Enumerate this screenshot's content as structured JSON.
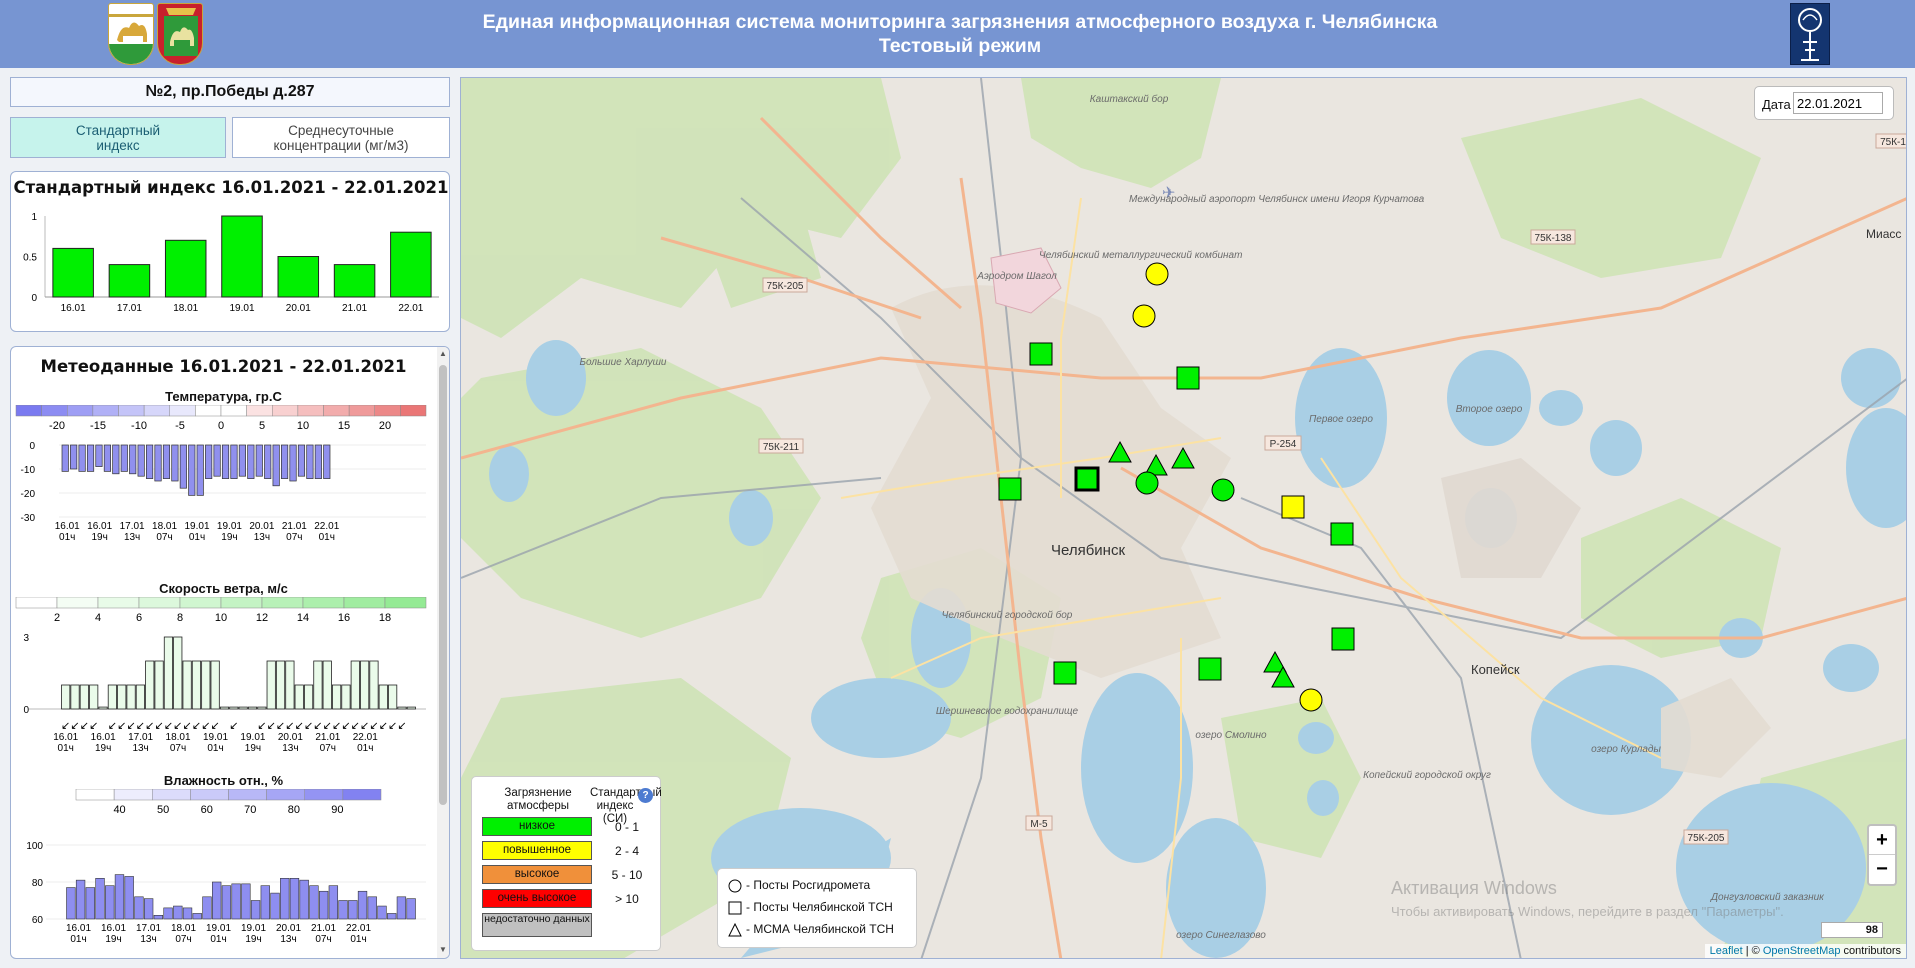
{
  "header": {
    "title": "Единая информационная система мониторинга загрязнения атмосферного воздуха г. Челябинска",
    "subtitle": "Тестовый режим",
    "colors": {
      "bg": "#7795d2"
    }
  },
  "station": {
    "label": "№2, пр.Победы д.287"
  },
  "tabs": [
    {
      "label_line1": "Стандартный",
      "label_line2": "индекс"
    },
    {
      "label_line1": "Среднесуточные",
      "label_line2": "концентрации (мг/м3)"
    }
  ],
  "chart_data": [
    {
      "type": "bar",
      "title": "Стандартный индекс 16.01.2021 - 22.01.2021",
      "categories": [
        "16.01",
        "17.01",
        "18.01",
        "19.01",
        "20.01",
        "21.01",
        "22.01"
      ],
      "values": [
        0.6,
        0.4,
        0.7,
        1.0,
        0.5,
        0.4,
        0.8
      ],
      "ylim": [
        0,
        1
      ],
      "yticks": [
        "0",
        "0.5",
        "1"
      ],
      "bar_color": "#00f000"
    },
    {
      "type": "bar",
      "title": "Температура, гр.С",
      "ylim": [
        -30,
        0
      ],
      "yticks": [
        "0",
        "-10",
        "-20",
        "-30"
      ],
      "values": [
        -11,
        -10,
        -11,
        -11,
        -9,
        -11,
        -12,
        -11,
        -12,
        -13,
        -14,
        -15,
        -14,
        -15,
        -18,
        -21,
        -21,
        -14,
        -13,
        -14,
        -14,
        -13,
        -14,
        -13,
        -14,
        -17,
        -14,
        -15,
        -13,
        -14,
        -14,
        -14
      ],
      "x_labels": [
        [
          "16.01",
          "01ч"
        ],
        [
          "16.01",
          "19ч"
        ],
        [
          "17.01",
          "13ч"
        ],
        [
          "18.01",
          "07ч"
        ],
        [
          "19.01",
          "01ч"
        ],
        [
          "19.01",
          "19ч"
        ],
        [
          "20.01",
          "13ч"
        ],
        [
          "21.01",
          "07ч"
        ],
        [
          "22.01",
          "01ч"
        ]
      ],
      "scale": [
        "-20",
        "-15",
        "-10",
        "-5",
        "0",
        "5",
        "10",
        "15",
        "20"
      ],
      "bar_color": "#9090ee"
    },
    {
      "type": "bar",
      "title": "Скорость ветра, м/с",
      "ylim": [
        0,
        3
      ],
      "yticks": [
        "3",
        "0"
      ],
      "values": [
        1,
        1,
        1,
        1,
        0,
        1,
        1,
        1,
        1,
        2,
        2,
        3,
        3,
        2,
        2,
        2,
        2,
        0,
        0,
        0,
        0,
        0,
        2,
        2,
        2,
        1,
        1,
        2,
        2,
        1,
        1,
        2,
        2,
        2,
        1,
        1,
        0,
        0
      ],
      "x_labels": [
        [
          "16.01",
          "01ч"
        ],
        [
          "16.01",
          "19ч"
        ],
        [
          "17.01",
          "13ч"
        ],
        [
          "18.01",
          "07ч"
        ],
        [
          "19.01",
          "01ч"
        ],
        [
          "19.01",
          "19ч"
        ],
        [
          "20.01",
          "13ч"
        ],
        [
          "21.01",
          "07ч"
        ],
        [
          "22.01",
          "01ч"
        ]
      ],
      "scale": [
        "2",
        "4",
        "6",
        "8",
        "10",
        "12",
        "14",
        "16",
        "18"
      ],
      "bar_color": "#eafbea"
    },
    {
      "type": "bar",
      "title": "Влажность отн., %",
      "ylim": [
        60,
        100
      ],
      "yticks": [
        "100",
        "80",
        "60"
      ],
      "values": [
        77,
        81,
        77,
        82,
        78,
        84,
        83,
        72,
        71,
        62,
        66,
        67,
        66,
        63,
        72,
        80,
        78,
        79,
        79,
        70,
        78,
        74,
        82,
        82,
        81,
        78,
        75,
        78,
        70,
        70,
        75,
        72,
        67,
        63,
        72,
        71
      ],
      "x_labels": [
        [
          "16.01",
          "01ч"
        ],
        [
          "16.01",
          "19ч"
        ],
        [
          "17.01",
          "13ч"
        ],
        [
          "18.01",
          "07ч"
        ],
        [
          "19.01",
          "01ч"
        ],
        [
          "19.01",
          "19ч"
        ],
        [
          "20.01",
          "13ч"
        ],
        [
          "21.01",
          "07ч"
        ],
        [
          "22.01",
          "01ч"
        ]
      ],
      "scale": [
        "40",
        "50",
        "60",
        "70",
        "80",
        "90"
      ],
      "bar_color": "#8e8ef0"
    }
  ],
  "meteo": {
    "title": "Метеоданные 16.01.2021 - 22.01.2021"
  },
  "map": {
    "date_label": "Дата",
    "date_value": "22.01.2021",
    "places": {
      "chelyabinsk": "Челябинск",
      "kopeysk": "Копейск",
      "kashtak": "Каштакский бор",
      "airport": "Международный аэропорт Челябинск имени Игоря Курчатова",
      "chmk": "Челябинский металлургический комбинат",
      "shagol": "Аэродром Шагол",
      "b_harlushi": "Большие Харлуши",
      "pervoe": "Первое озеро",
      "vtoroe": "Второе озеро",
      "gorbor": "Челябинский городской бор",
      "shersh": "Шершневское водохранилище",
      "smolino": "озеро Смолино",
      "kopgor": "Копейский городской округ",
      "kurlady": "озеро Курлады",
      "sinegla": "озеро Синеглазово",
      "dongz": "Донгузловский заказник",
      "miass": "Миасс"
    },
    "roads": [
      "75К-205",
      "75К-211",
      "75К-138",
      "Р-254",
      "М-5",
      "75К-205",
      "75К-1"
    ],
    "legend": {
      "col1": "Загрязнение атмосферы",
      "col2": "Стандартный индекс (СИ)",
      "help": "?",
      "levels": [
        {
          "label": "низкое",
          "range": "0  -  1",
          "color": "#00f000"
        },
        {
          "label": "повышенное",
          "range": "2  -  4",
          "color": "#ffff00"
        },
        {
          "label": "высокое",
          "range": "5  -  10",
          "color": "#f0903a"
        },
        {
          "label": "очень высокое",
          "range": ">  10",
          "color": "#ff0000"
        },
        {
          "label": "недостаточно данных",
          "range": "",
          "color": "#c0c0c0"
        }
      ]
    },
    "station_types": [
      {
        "label": "- Посты Росгидромета",
        "shape": "circle"
      },
      {
        "label": "- Посты Челябинской ТСН",
        "shape": "square"
      },
      {
        "label": "- МСМА Челябинской ТСН",
        "shape": "triangle"
      }
    ],
    "zoom_in": "+",
    "zoom_out": "−",
    "counter": "98",
    "watermark_1": "Активация Windows",
    "watermark_2": "Чтобы активировать Windows, перейдите в раздел \"Параметры\".",
    "attribution_leaflet": "Leaflet",
    "attribution_sep": " | © ",
    "attribution_osm": "OpenStreetMap",
    "attribution_tail": " contributors",
    "markers": [
      {
        "shape": "circle",
        "level": "yellow"
      },
      {
        "shape": "circle",
        "level": "yellow"
      },
      {
        "shape": "square",
        "level": "green"
      },
      {
        "shape": "square",
        "level": "green"
      },
      {
        "shape": "triangle",
        "level": "green"
      },
      {
        "shape": "triangle",
        "level": "green"
      },
      {
        "shape": "triangle",
        "level": "green"
      },
      {
        "shape": "square",
        "level": "green"
      },
      {
        "shape": "square",
        "level": "green",
        "selected": true
      },
      {
        "shape": "circle",
        "level": "green"
      },
      {
        "shape": "circle",
        "level": "green"
      },
      {
        "shape": "square",
        "level": "yellow"
      },
      {
        "shape": "square",
        "level": "green"
      },
      {
        "shape": "square",
        "level": "green"
      },
      {
        "shape": "square",
        "level": "green"
      },
      {
        "shape": "square",
        "level": "green"
      },
      {
        "shape": "triangle",
        "level": "green"
      },
      {
        "shape": "triangle",
        "level": "green"
      },
      {
        "shape": "circle",
        "level": "yellow"
      }
    ]
  }
}
